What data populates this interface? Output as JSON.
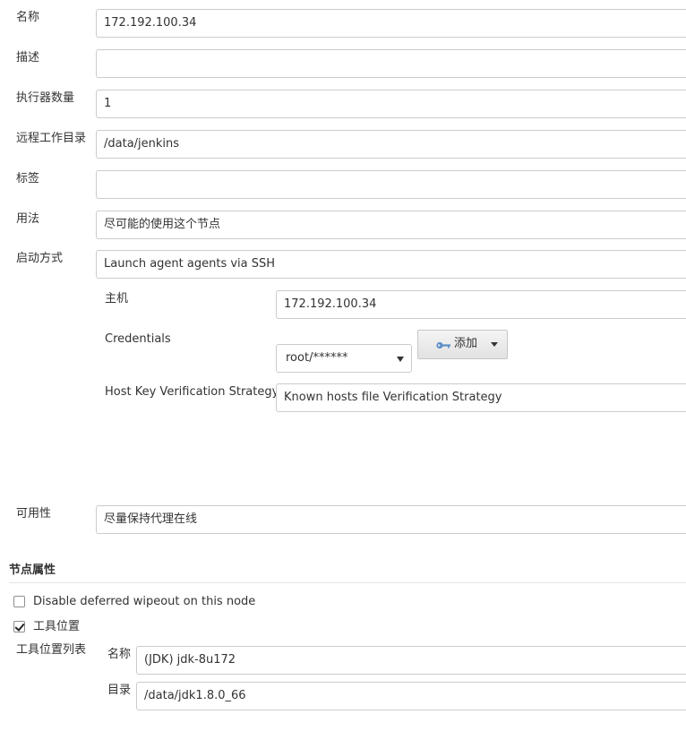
{
  "form": {
    "name_label": "名称",
    "name_value": "172.192.100.34",
    "description_label": "描述",
    "description_value": "",
    "executors_label": "执行器数量",
    "executors_value": "1",
    "remote_dir_label": "远程工作目录",
    "remote_dir_value": "/data/jenkins",
    "labels_label": "标签",
    "labels_value": "",
    "usage_label": "用法",
    "usage_value": "尽可能的使用这个节点",
    "launch_label": "启动方式",
    "launch_value": "Launch agent agents via SSH"
  },
  "ssh": {
    "host_label": "主机",
    "host_value": "172.192.100.34",
    "credentials_label": "Credentials",
    "credentials_value": "root/******",
    "add_button_label": "添加",
    "host_key_label": "Host Key Verification Strategy",
    "host_key_value": "Known hosts file Verification Strategy"
  },
  "availability": {
    "label": "可用性",
    "value": "尽量保持代理在线"
  },
  "node_properties": {
    "title": "节点属性",
    "disable_wipeout_label": "Disable deferred wipeout on this node",
    "disable_wipeout_checked": false,
    "tool_locations_label": "工具位置",
    "tool_locations_checked": true,
    "tool_list_label": "工具位置列表",
    "tool_name_label": "名称",
    "tool_name_value": "(JDK) jdk-8u172",
    "tool_dir_label": "目录",
    "tool_dir_value": "/data/jdk1.8.0_66"
  },
  "colors": {
    "border": "#cccccc",
    "text": "#333333",
    "key_icon": "#5b8fc7"
  }
}
